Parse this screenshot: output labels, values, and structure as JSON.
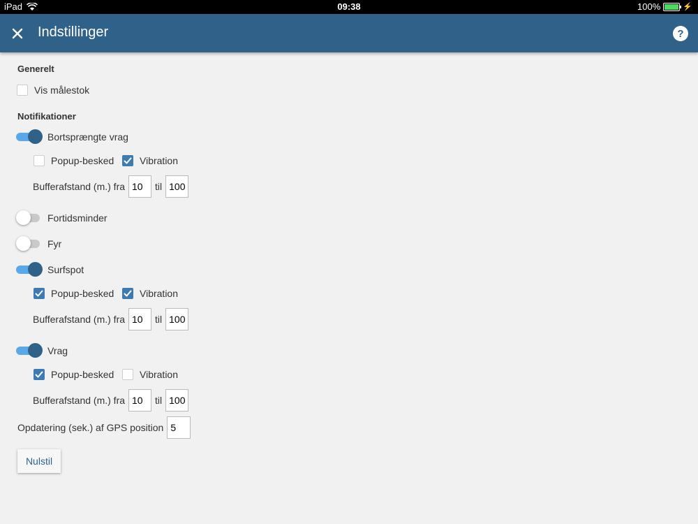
{
  "status_bar": {
    "device": "iPad",
    "time": "09:38",
    "battery_percent": "100%"
  },
  "app_bar": {
    "title": "Indstillinger"
  },
  "general": {
    "heading": "Generelt",
    "show_scale": {
      "label": "Vis målestok",
      "checked": false
    }
  },
  "notifications": {
    "heading": "Notifikationer",
    "popup_label": "Popup-besked",
    "vibration_label": "Vibration",
    "buffer_label": "Bufferafstand (m.) fra",
    "til_label": "til",
    "items": [
      {
        "label": "Bortsprængte vrag",
        "enabled": true,
        "popup": false,
        "vibration": true,
        "buffer_from": "10",
        "buffer_to": "100"
      },
      {
        "label": "Fortidsminder",
        "enabled": false
      },
      {
        "label": "Fyr",
        "enabled": false
      },
      {
        "label": "Surfspot",
        "enabled": true,
        "popup": true,
        "vibration": true,
        "buffer_from": "10",
        "buffer_to": "100"
      },
      {
        "label": "Vrag",
        "enabled": true,
        "popup": true,
        "vibration": false,
        "buffer_from": "10",
        "buffer_to": "100"
      }
    ]
  },
  "gps": {
    "label": "Opdatering (sek.) af GPS position",
    "value": "5"
  },
  "reset_button": {
    "label": "Nulstil"
  },
  "colors": {
    "accent": "#2f6189",
    "toggle_track_on": "#5ba8e8",
    "checkbox_checked": "#3d7ab3",
    "background": "#f1f1f1"
  }
}
